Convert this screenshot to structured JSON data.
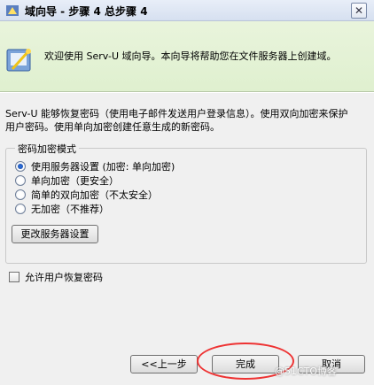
{
  "window": {
    "title": "域向导 - 步骤 4 总步骤 4",
    "close_glyph": "✕"
  },
  "header": {
    "text": "欢迎使用 Serv-U 域向导。本向导将帮助您在文件服务器上创建域。"
  },
  "description": {
    "line1": "Serv-U 能够恢复密码（使用电子邮件发送用户登录信息）。使用双向加密来保护",
    "line2": "用户密码。使用单向加密创建任意生成的新密码。"
  },
  "encryption_group": {
    "legend": "密码加密模式",
    "options": [
      {
        "label": "使用服务器设置 (加密: 单向加密)",
        "checked": true
      },
      {
        "label": "单向加密（更安全）",
        "checked": false
      },
      {
        "label": "简单的双向加密（不太安全）",
        "checked": false
      },
      {
        "label": "无加密（不推荐）",
        "checked": false
      }
    ],
    "change_button": "更改服务器设置"
  },
  "allow_recovery": {
    "label": "允许用户恢复密码",
    "checked": false
  },
  "buttons": {
    "back": "<<上一步",
    "finish": "完成",
    "cancel": "取消"
  },
  "watermark": "@51CTO博客",
  "colors": {
    "header_band": "#e3f2d4",
    "highlight_ring": "#e33333"
  }
}
